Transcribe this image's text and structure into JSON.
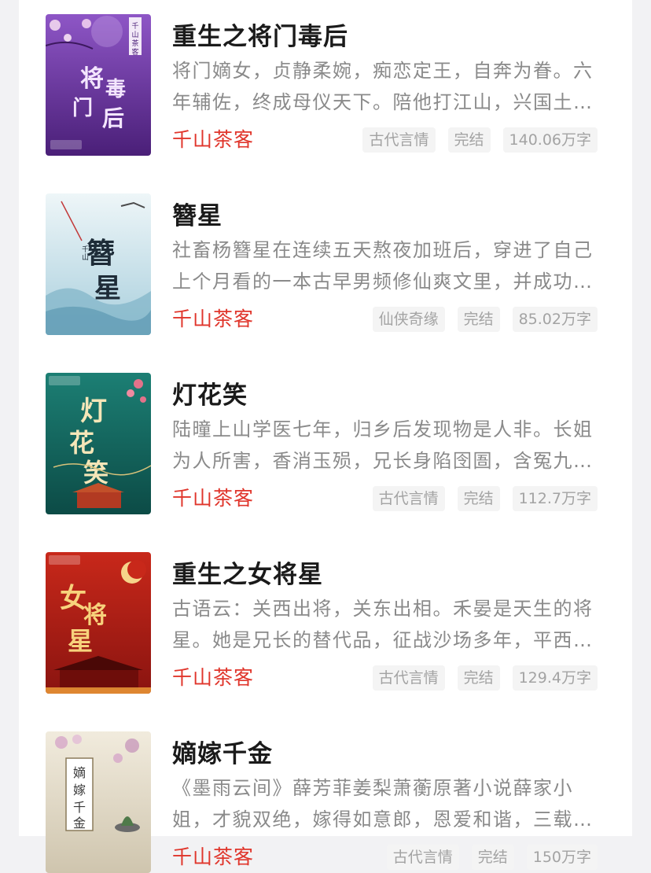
{
  "books": [
    {
      "title": "重生之将门毒后",
      "description": "将门嫡女，贞静柔婉，痴恋定王，自奔为眷。六年辅佐，终成母仪天下。陪他打江山，兴国土…",
      "author": "千山茶客",
      "tags": [
        "古代言情",
        "完结",
        "140.06万字"
      ],
      "cover": {
        "main_text": "将门毒后",
        "colors": [
          "#5b2a8c",
          "#8e56c6"
        ]
      }
    },
    {
      "title": "簪星",
      "description": "社畜杨簪星在连续五天熬夜加班后，穿进了自己上个月看的一本古早男频修仙爽文里，并成功…",
      "author": "千山茶客",
      "tags": [
        "仙侠奇缘",
        "完结",
        "85.02万字"
      ],
      "cover": {
        "main_text": "簪星",
        "colors": [
          "#dfeef3",
          "#9ec6d6"
        ]
      }
    },
    {
      "title": "灯花笑",
      "description": "陆曈上山学医七年，归乡后发现物是人非。长姐为人所害，香消玉殒，兄长身陷囹圄，含冤九…",
      "author": "千山茶客",
      "tags": [
        "古代言情",
        "完结",
        "112.7万字"
      ],
      "cover": {
        "main_text": "灯花笑",
        "colors": [
          "#0e5a54",
          "#1f8a7c"
        ]
      }
    },
    {
      "title": "重生之女将星",
      "description": "古语云：关西出将，关东出相。禾晏是天生的将星。她是兄长的替代品，征战沙场多年，平西…",
      "author": "千山茶客",
      "tags": [
        "古代言情",
        "完结",
        "129.4万字"
      ],
      "cover": {
        "main_text": "女将星",
        "colors": [
          "#b11d14",
          "#e2472c"
        ]
      }
    },
    {
      "title": "嫡嫁千金",
      "description": "《墨雨云间》薛芳菲姜梨萧蘅原著小说薛家小姐，才貌双绝，嫁得如意郎，恩爱和谐，三载相…",
      "author": "千山茶客",
      "tags": [
        "古代言情",
        "完结",
        "150万字"
      ],
      "cover": {
        "main_text": "嫡嫁千金",
        "colors": [
          "#ede6d6",
          "#c9bfa8"
        ]
      }
    }
  ]
}
